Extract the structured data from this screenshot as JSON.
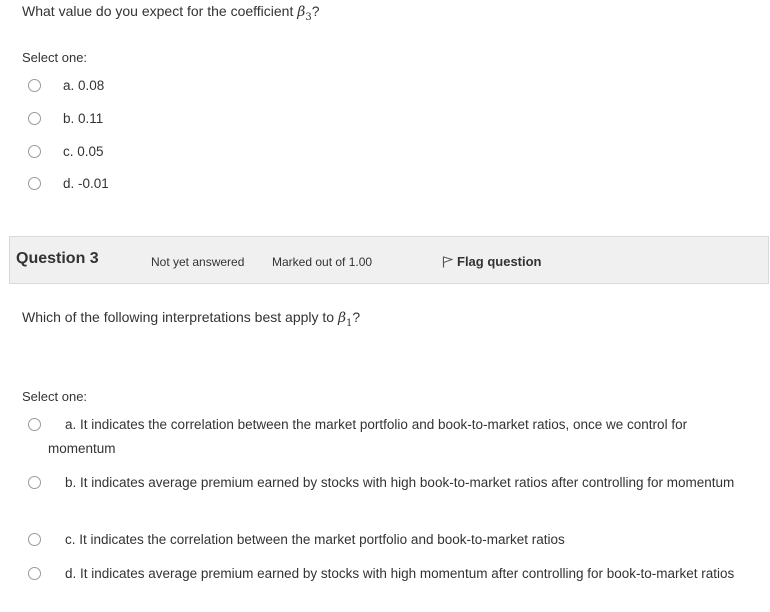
{
  "question2": {
    "prompt_text": "What value do you expect for the coefficient ",
    "prompt_symbol": "β",
    "prompt_sub": "3",
    "prompt_end": "?",
    "select_label": "Select one:",
    "options": [
      {
        "label": "a. 0.08"
      },
      {
        "label": "b. 0.11"
      },
      {
        "label": "c. 0.05"
      },
      {
        "label": "d. -0.01"
      }
    ]
  },
  "question3_info": {
    "number_label": "Question 3",
    "state": "Not yet answered",
    "grade": "Marked out of 1.00",
    "flag_label": "Flag question",
    "flag_icon": "flag-outline-icon"
  },
  "question3": {
    "prompt_text": "Which of the following interpretations best apply to ",
    "prompt_symbol": "β",
    "prompt_sub": "1",
    "prompt_end": "?",
    "select_label": "Select one:",
    "options": [
      {
        "label": "a. It indicates the correlation between the market portfolio and book-to-market ratios, once we control for momentum"
      },
      {
        "label": "b. It indicates average premium earned by stocks with high book-to-market ratios after controlling for momentum"
      },
      {
        "label": "c. It indicates the correlation between the market portfolio and book-to-market ratios"
      },
      {
        "label": "d. It indicates average premium earned by stocks with high momentum after controlling for book-to-market ratios"
      }
    ]
  }
}
